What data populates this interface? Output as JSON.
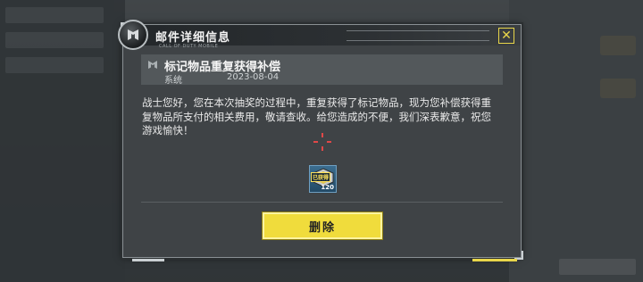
{
  "dialog": {
    "title": "邮件详细信息",
    "logo_caption": "CALL OF DUTY MOBILE",
    "close_symbol": "✕"
  },
  "mail": {
    "subject": "标记物品重复获得补偿",
    "sender": "系统",
    "date": "2023-08-04",
    "body": "战士您好，您在本次抽奖的过程中，重复获得了标记物品，现为您补偿获得重复物品所支付的相关费用，敬请查收。给您造成的不便，我们深表歉意，祝您游戏愉快！"
  },
  "attachment": {
    "badge": "已获得",
    "count": "120",
    "icon": "currency-crate-icon"
  },
  "actions": {
    "delete_label": "删除"
  },
  "colors": {
    "accent_yellow": "#f0dc3c",
    "dialog_bg": "#3f4346",
    "crosshair_red": "#e04848"
  }
}
